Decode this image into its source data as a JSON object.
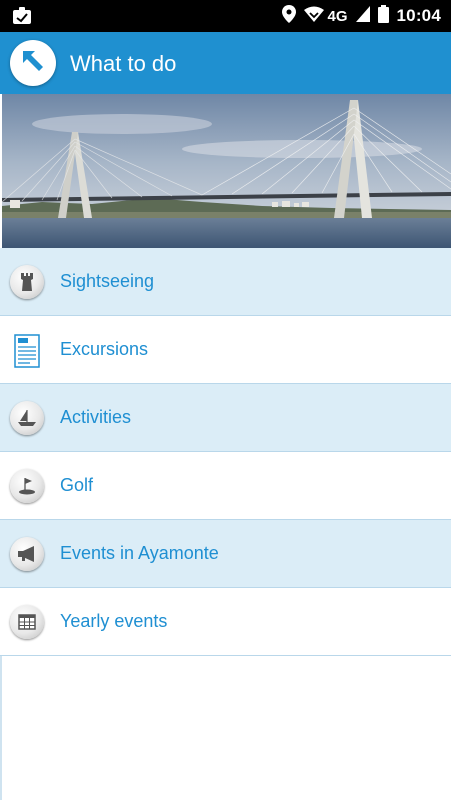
{
  "status_bar": {
    "network": "4G",
    "time": "10:04",
    "icons": [
      "clipboard-icon",
      "location-icon",
      "wifi-icon",
      "signal-icon",
      "battery-icon"
    ]
  },
  "app_bar": {
    "title": "What to do",
    "back_icon": "arrow-up-left-icon",
    "color": "#1f90d0"
  },
  "hero": {
    "image": "cable-stayed-bridge-over-river-photo"
  },
  "menu": {
    "items": [
      {
        "label": "Sightseeing",
        "icon": "tower-icon"
      },
      {
        "label": "Excursions",
        "icon": "pdf-document-icon"
      },
      {
        "label": "Activities",
        "icon": "sailboat-icon"
      },
      {
        "label": "Golf",
        "icon": "golf-icon"
      },
      {
        "label": "Events in Ayamonte",
        "icon": "megaphone-icon"
      },
      {
        "label": "Yearly events",
        "icon": "calendar-icon"
      }
    ],
    "accent_color": "#1f8fd2",
    "alt_row_color": "#dbedf7"
  }
}
